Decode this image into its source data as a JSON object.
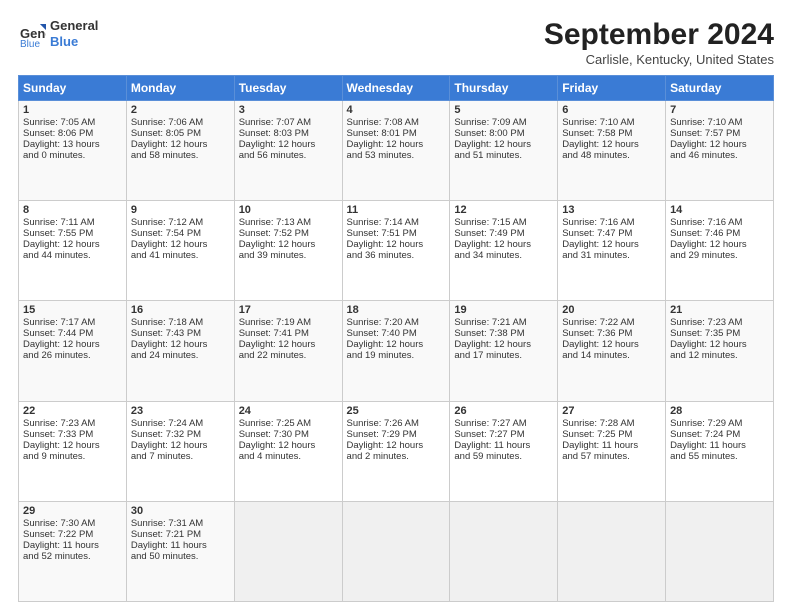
{
  "header": {
    "logo_line1": "General",
    "logo_line2": "Blue",
    "month": "September 2024",
    "location": "Carlisle, Kentucky, United States"
  },
  "days_of_week": [
    "Sunday",
    "Monday",
    "Tuesday",
    "Wednesday",
    "Thursday",
    "Friday",
    "Saturday"
  ],
  "weeks": [
    [
      {
        "day": "1",
        "lines": [
          "Sunrise: 7:05 AM",
          "Sunset: 8:06 PM",
          "Daylight: 13 hours",
          "and 0 minutes."
        ]
      },
      {
        "day": "2",
        "lines": [
          "Sunrise: 7:06 AM",
          "Sunset: 8:05 PM",
          "Daylight: 12 hours",
          "and 58 minutes."
        ]
      },
      {
        "day": "3",
        "lines": [
          "Sunrise: 7:07 AM",
          "Sunset: 8:03 PM",
          "Daylight: 12 hours",
          "and 56 minutes."
        ]
      },
      {
        "day": "4",
        "lines": [
          "Sunrise: 7:08 AM",
          "Sunset: 8:01 PM",
          "Daylight: 12 hours",
          "and 53 minutes."
        ]
      },
      {
        "day": "5",
        "lines": [
          "Sunrise: 7:09 AM",
          "Sunset: 8:00 PM",
          "Daylight: 12 hours",
          "and 51 minutes."
        ]
      },
      {
        "day": "6",
        "lines": [
          "Sunrise: 7:10 AM",
          "Sunset: 7:58 PM",
          "Daylight: 12 hours",
          "and 48 minutes."
        ]
      },
      {
        "day": "7",
        "lines": [
          "Sunrise: 7:10 AM",
          "Sunset: 7:57 PM",
          "Daylight: 12 hours",
          "and 46 minutes."
        ]
      }
    ],
    [
      {
        "day": "8",
        "lines": [
          "Sunrise: 7:11 AM",
          "Sunset: 7:55 PM",
          "Daylight: 12 hours",
          "and 44 minutes."
        ]
      },
      {
        "day": "9",
        "lines": [
          "Sunrise: 7:12 AM",
          "Sunset: 7:54 PM",
          "Daylight: 12 hours",
          "and 41 minutes."
        ]
      },
      {
        "day": "10",
        "lines": [
          "Sunrise: 7:13 AM",
          "Sunset: 7:52 PM",
          "Daylight: 12 hours",
          "and 39 minutes."
        ]
      },
      {
        "day": "11",
        "lines": [
          "Sunrise: 7:14 AM",
          "Sunset: 7:51 PM",
          "Daylight: 12 hours",
          "and 36 minutes."
        ]
      },
      {
        "day": "12",
        "lines": [
          "Sunrise: 7:15 AM",
          "Sunset: 7:49 PM",
          "Daylight: 12 hours",
          "and 34 minutes."
        ]
      },
      {
        "day": "13",
        "lines": [
          "Sunrise: 7:16 AM",
          "Sunset: 7:47 PM",
          "Daylight: 12 hours",
          "and 31 minutes."
        ]
      },
      {
        "day": "14",
        "lines": [
          "Sunrise: 7:16 AM",
          "Sunset: 7:46 PM",
          "Daylight: 12 hours",
          "and 29 minutes."
        ]
      }
    ],
    [
      {
        "day": "15",
        "lines": [
          "Sunrise: 7:17 AM",
          "Sunset: 7:44 PM",
          "Daylight: 12 hours",
          "and 26 minutes."
        ]
      },
      {
        "day": "16",
        "lines": [
          "Sunrise: 7:18 AM",
          "Sunset: 7:43 PM",
          "Daylight: 12 hours",
          "and 24 minutes."
        ]
      },
      {
        "day": "17",
        "lines": [
          "Sunrise: 7:19 AM",
          "Sunset: 7:41 PM",
          "Daylight: 12 hours",
          "and 22 minutes."
        ]
      },
      {
        "day": "18",
        "lines": [
          "Sunrise: 7:20 AM",
          "Sunset: 7:40 PM",
          "Daylight: 12 hours",
          "and 19 minutes."
        ]
      },
      {
        "day": "19",
        "lines": [
          "Sunrise: 7:21 AM",
          "Sunset: 7:38 PM",
          "Daylight: 12 hours",
          "and 17 minutes."
        ]
      },
      {
        "day": "20",
        "lines": [
          "Sunrise: 7:22 AM",
          "Sunset: 7:36 PM",
          "Daylight: 12 hours",
          "and 14 minutes."
        ]
      },
      {
        "day": "21",
        "lines": [
          "Sunrise: 7:23 AM",
          "Sunset: 7:35 PM",
          "Daylight: 12 hours",
          "and 12 minutes."
        ]
      }
    ],
    [
      {
        "day": "22",
        "lines": [
          "Sunrise: 7:23 AM",
          "Sunset: 7:33 PM",
          "Daylight: 12 hours",
          "and 9 minutes."
        ]
      },
      {
        "day": "23",
        "lines": [
          "Sunrise: 7:24 AM",
          "Sunset: 7:32 PM",
          "Daylight: 12 hours",
          "and 7 minutes."
        ]
      },
      {
        "day": "24",
        "lines": [
          "Sunrise: 7:25 AM",
          "Sunset: 7:30 PM",
          "Daylight: 12 hours",
          "and 4 minutes."
        ]
      },
      {
        "day": "25",
        "lines": [
          "Sunrise: 7:26 AM",
          "Sunset: 7:29 PM",
          "Daylight: 12 hours",
          "and 2 minutes."
        ]
      },
      {
        "day": "26",
        "lines": [
          "Sunrise: 7:27 AM",
          "Sunset: 7:27 PM",
          "Daylight: 11 hours",
          "and 59 minutes."
        ]
      },
      {
        "day": "27",
        "lines": [
          "Sunrise: 7:28 AM",
          "Sunset: 7:25 PM",
          "Daylight: 11 hours",
          "and 57 minutes."
        ]
      },
      {
        "day": "28",
        "lines": [
          "Sunrise: 7:29 AM",
          "Sunset: 7:24 PM",
          "Daylight: 11 hours",
          "and 55 minutes."
        ]
      }
    ],
    [
      {
        "day": "29",
        "lines": [
          "Sunrise: 7:30 AM",
          "Sunset: 7:22 PM",
          "Daylight: 11 hours",
          "and 52 minutes."
        ]
      },
      {
        "day": "30",
        "lines": [
          "Sunrise: 7:31 AM",
          "Sunset: 7:21 PM",
          "Daylight: 11 hours",
          "and 50 minutes."
        ]
      },
      {
        "day": "",
        "lines": []
      },
      {
        "day": "",
        "lines": []
      },
      {
        "day": "",
        "lines": []
      },
      {
        "day": "",
        "lines": []
      },
      {
        "day": "",
        "lines": []
      }
    ]
  ]
}
